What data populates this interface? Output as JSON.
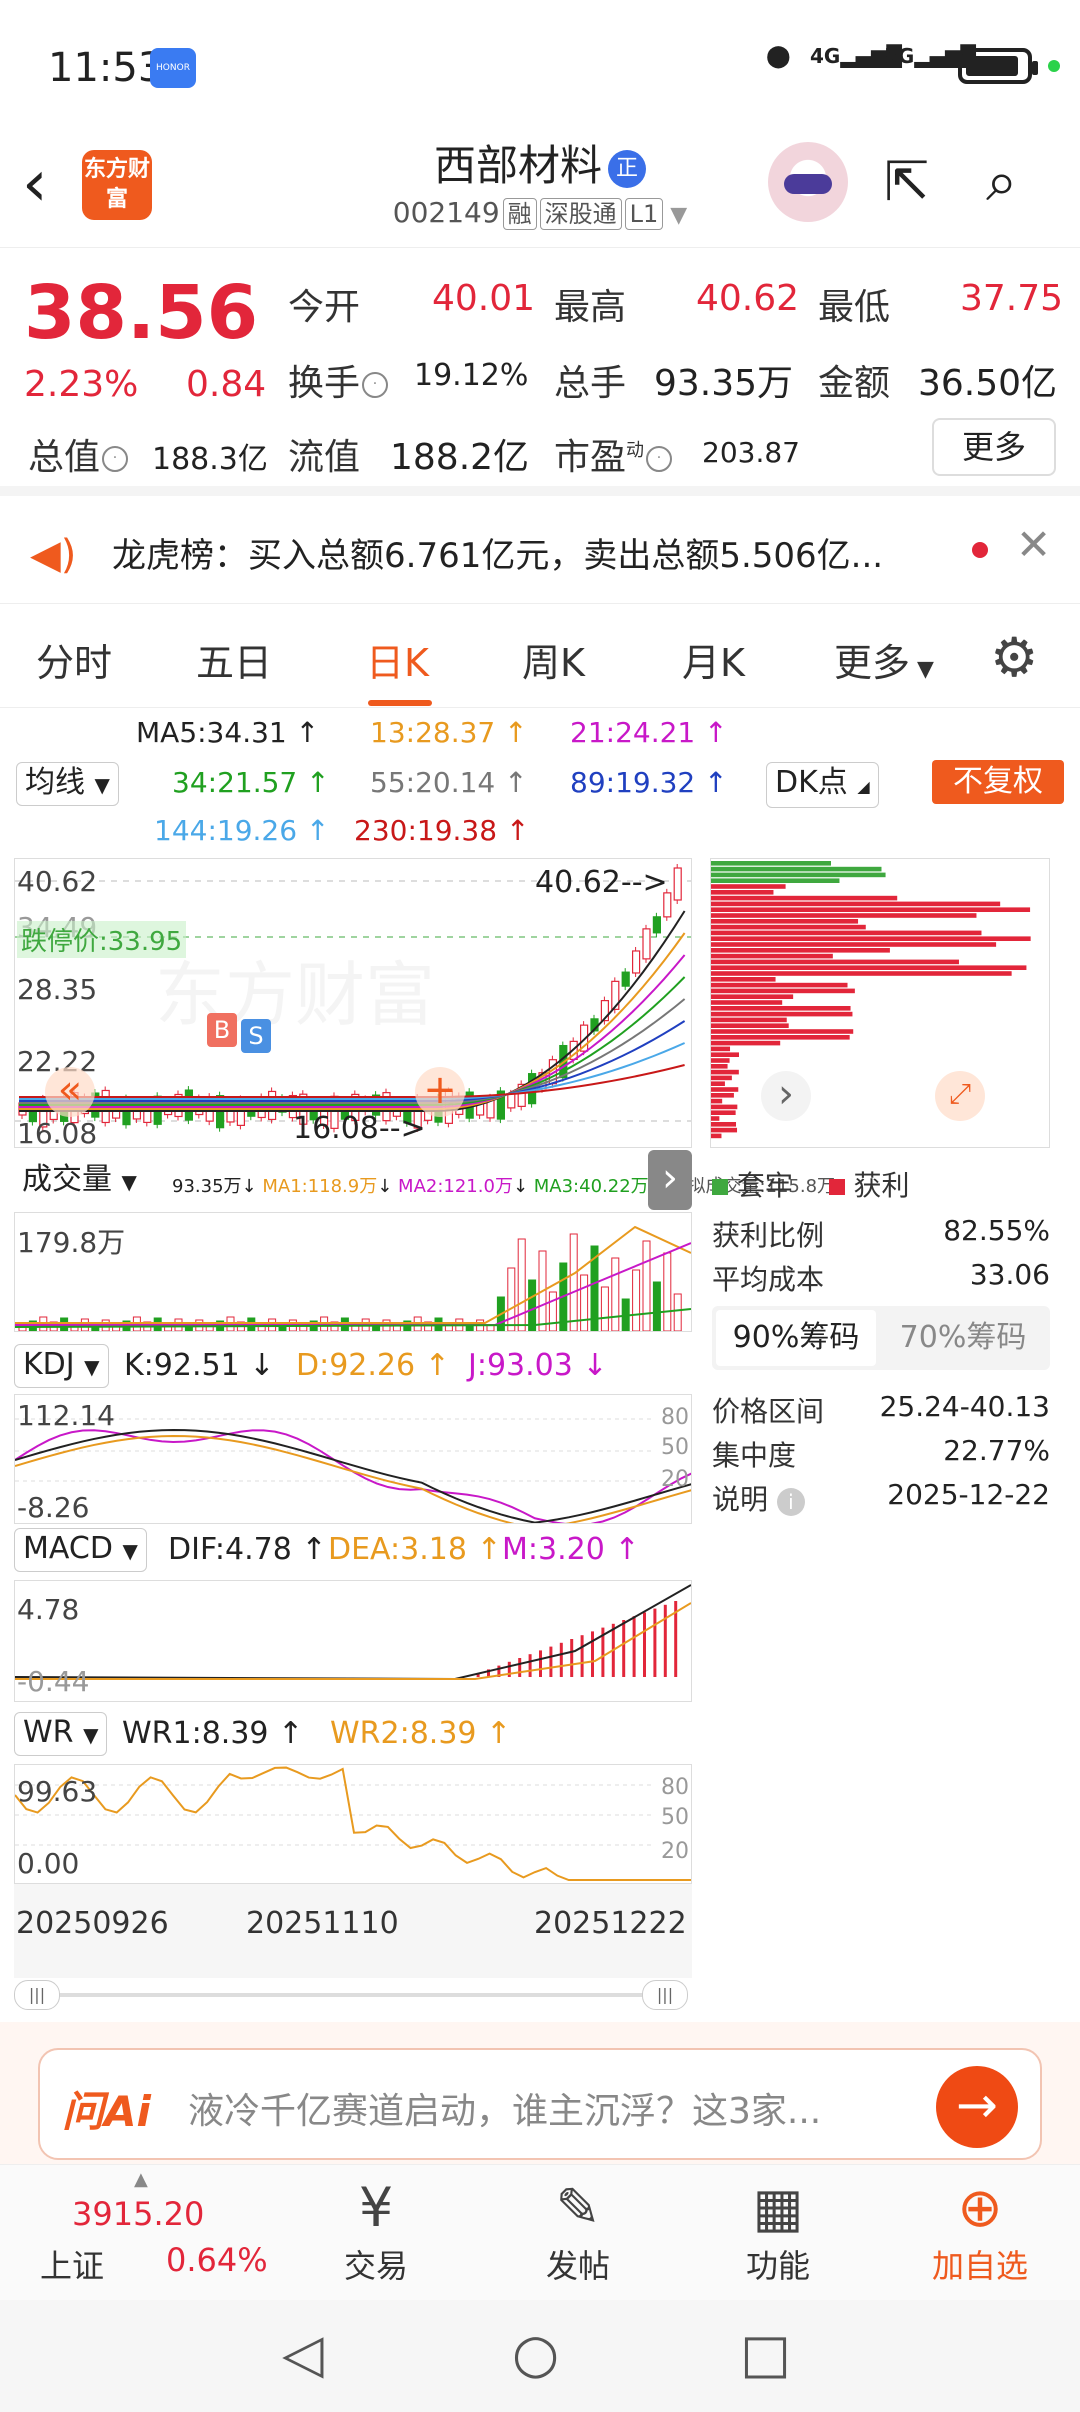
{
  "status": {
    "time": "11:53",
    "brand": "HONOR",
    "net1": "4G",
    "net2": "5G"
  },
  "header": {
    "logo": "东方财富",
    "name": "西部材料",
    "badge": "正",
    "code": "002149",
    "tags": [
      "融",
      "深股通",
      "L1"
    ]
  },
  "quote": {
    "price": "38.56",
    "pct": "2.23%",
    "chg": "0.84",
    "rows": [
      [
        {
          "k": "今开",
          "v": "40.01"
        },
        {
          "k": "最高",
          "v": "40.62"
        },
        {
          "k": "最低",
          "v": "37.75"
        }
      ],
      [
        {
          "k": "换手",
          "v": "19.12%"
        },
        {
          "k": "总手",
          "v": "93.35万"
        },
        {
          "k": "金额",
          "v": "36.50亿"
        }
      ],
      [
        {
          "k": "总值",
          "v": "188.3亿"
        },
        {
          "k": "流值",
          "v": "188.2亿"
        },
        {
          "k": "市盈",
          "sup": "动",
          "v": "203.87"
        }
      ]
    ],
    "more": "更多"
  },
  "notice": {
    "text": "龙虎榜：买入总额6.761亿元，卖出总额5.506亿..."
  },
  "tabs": [
    "分时",
    "五日",
    "日K",
    "周K",
    "月K",
    "更多"
  ],
  "active_tab": "日K",
  "ma": {
    "selector": "均线",
    "dk": "DK点",
    "fq": "不复权",
    "items": [
      {
        "label": "MA5:34.31",
        "color": "#222222"
      },
      {
        "label": "13:28.37",
        "color": "#e89a1f"
      },
      {
        "label": "21:24.21",
        "color": "#c818c8"
      },
      {
        "label": "34:21.57",
        "color": "#20a020"
      },
      {
        "label": "55:20.14",
        "color": "#777777"
      },
      {
        "label": "89:19.32",
        "color": "#2040c0"
      },
      {
        "label": "144:19.26",
        "color": "#4aa8e8"
      },
      {
        "label": "230:19.38",
        "color": "#c81818"
      }
    ]
  },
  "kline": {
    "y_labels": [
      "40.62",
      "34.49",
      "28.35",
      "22.22",
      "16.08"
    ],
    "limit_down": "跌停价:33.95",
    "high_mark": "40.62",
    "low_mark": "16.08",
    "b": "B",
    "s": "S",
    "watermark": "东方财富"
  },
  "volume": {
    "selector": "成交量",
    "info": [
      {
        "t": "93.35万",
        "c": "#222222"
      },
      {
        "t": "MA1:118.9万",
        "c": "#e89a1f"
      },
      {
        "t": "MA2:121.0万",
        "c": "#c818c8"
      },
      {
        "t": "MA3:40.22万",
        "c": "#20a020"
      },
      {
        "t": "虚拟成交量:115.8万",
        "c": "#555555"
      }
    ],
    "max": "179.8万"
  },
  "kdj": {
    "selector": "KDJ",
    "k": "K:92.51",
    "d": "D:92.26",
    "j": "J:93.03",
    "top": "112.14",
    "bottom": "-8.26",
    "ticks": [
      "80",
      "50",
      "20"
    ]
  },
  "macd": {
    "selector": "MACD",
    "dif": "DIF:4.78",
    "dea": "DEA:3.18",
    "m": "M:3.20",
    "top": "4.78",
    "bottom": "-0.44"
  },
  "wr": {
    "selector": "WR",
    "wr1": "WR1:8.39",
    "wr2": "WR2:8.39",
    "top": "99.63",
    "bottom": "0.00",
    "ticks": [
      "80",
      "50",
      "20"
    ]
  },
  "dates": [
    "20250926",
    "20251110",
    "20251222"
  ],
  "chip": {
    "legend": [
      "套牢",
      "获利"
    ],
    "rows": [
      {
        "k": "获利比例",
        "v": "82.55%"
      },
      {
        "k": "平均成本",
        "v": "33.06"
      }
    ],
    "tab1": "90%筹码",
    "tab2": "70%筹码",
    "rows2": [
      {
        "k": "价格区间",
        "v": "25.24-40.13"
      },
      {
        "k": "集中度",
        "v": "22.77%"
      },
      {
        "k": "说明",
        "v": "2025-12-22"
      }
    ]
  },
  "ai": {
    "logo": "问Ai",
    "text": "液冷千亿赛道启动，谁主沉浮？这3家..."
  },
  "bottom": {
    "index_value": "3915.20",
    "index_name": "上证",
    "index_pct": "0.64%",
    "nav": [
      "交易",
      "发帖",
      "功能",
      "加自选"
    ]
  },
  "colors": {
    "accent": "#ef5a1e",
    "up": "#e2263a",
    "down": "#20a020"
  }
}
